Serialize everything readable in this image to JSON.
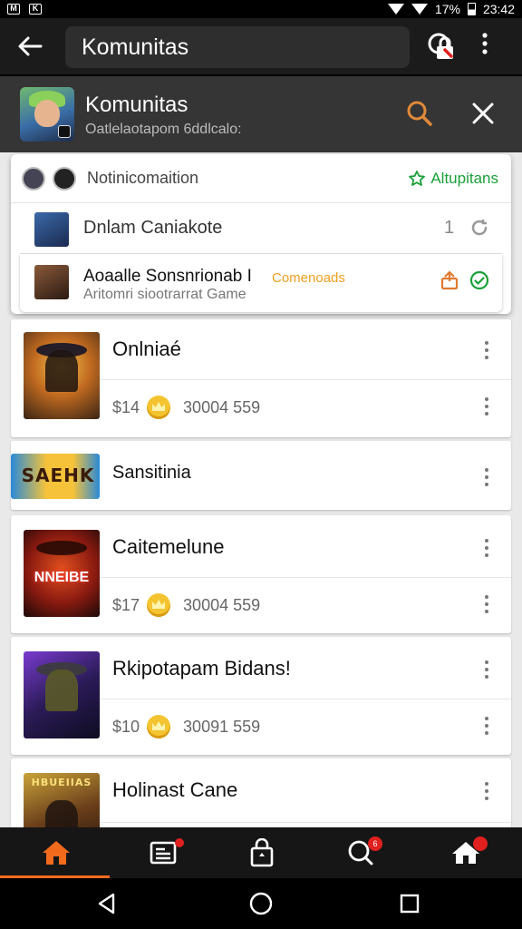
{
  "status": {
    "battery": "17%",
    "time": "23:42"
  },
  "appbar": {
    "title": "Komunitas"
  },
  "banner": {
    "title": "Komunitas",
    "subtitle": "Oatlelaotapom 6ddlcalo:"
  },
  "popup": {
    "notice": "Notinicomaition",
    "option": "Altupitans",
    "card1": {
      "text": "Dnlam Caniakote",
      "count": "1"
    },
    "card2": {
      "title": "Aoaalle Sonsnrionab I",
      "subtitle": "Aritomri siootrarrat Game",
      "tag": "Comenoads"
    }
  },
  "games": [
    {
      "name": "Onlniaé",
      "price": "$14",
      "amount": "30004 559"
    },
    {
      "name": "Sansitinia",
      "logo": "SAEHK"
    },
    {
      "name": "Caitemelune",
      "price": "$17",
      "amount": "30004 559",
      "logo": "NNEIBE"
    },
    {
      "name": "Rkipotapam Bidans!",
      "price": "$10",
      "amount": "30091 559"
    },
    {
      "name": "Holinast Cane",
      "logo": "HBUEIIAS"
    }
  ],
  "bottom_nav": {
    "items": [
      "home-icon",
      "news-icon",
      "shop-bag-icon",
      "search-alerts-icon",
      "house-alt-icon"
    ],
    "active_color": "#f26b1d",
    "badge_search": "6"
  }
}
